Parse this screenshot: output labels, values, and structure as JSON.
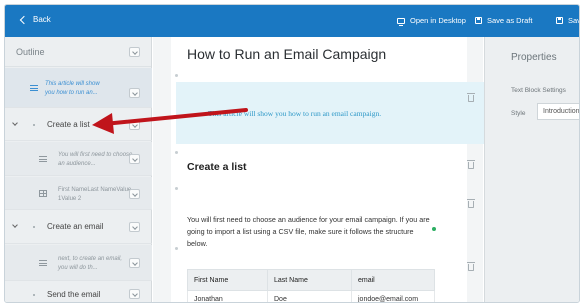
{
  "topbar": {
    "back_label": "Back",
    "open_desktop_label": "Open in Desktop",
    "save_draft_label": "Save as Draft",
    "save_label": "Sav"
  },
  "outline": {
    "title": "Outline",
    "items": [
      {
        "type": "text",
        "preview": [
          "This article will show",
          "you how to run an..."
        ]
      },
      {
        "type": "heading",
        "label": "Create a list"
      },
      {
        "type": "text",
        "preview": [
          "You will first need to choose",
          "an audience..."
        ]
      },
      {
        "type": "table",
        "preview": [
          "First NameLast NameValue",
          "1Value 2"
        ]
      },
      {
        "type": "heading",
        "label": "Create an email"
      },
      {
        "type": "text",
        "preview": [
          "next, to create an email,",
          "you will do th..."
        ]
      },
      {
        "type": "heading",
        "label": "Send the email"
      }
    ]
  },
  "article": {
    "title": "How to Run an Email  Campaign",
    "intro": "This article will show you how to run an email campaign.",
    "heading": "Create a list",
    "paragraph_lines": [
      "You will first need to choose an audience for your email campaign. If you are",
      "going to import a list using a CSV file, make sure it follows the structure",
      "below."
    ],
    "table": {
      "headers": [
        "First Name",
        "Last Name",
        "email"
      ],
      "row": [
        "Jonathan",
        "Doe",
        "jondoe@email.com"
      ]
    }
  },
  "properties": {
    "title": "Properties",
    "section": "Text Block Settings",
    "style_label": "Style",
    "style_value": "Introduction"
  },
  "colors": {
    "topbar": "#1a78c2",
    "accent": "#3b8fd2",
    "annotation_arrow": "#c0141b"
  }
}
